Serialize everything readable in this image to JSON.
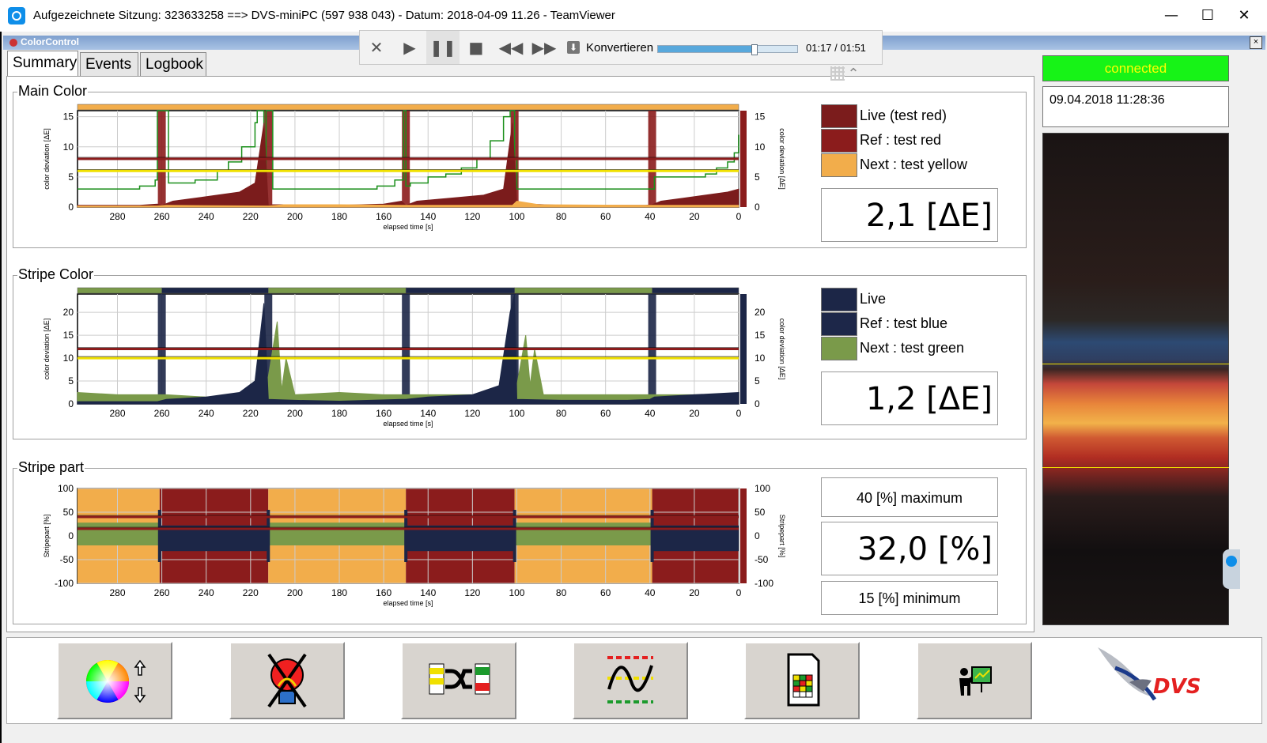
{
  "window": {
    "title": "Aufgezeichnete Sitzung: 323633258 ==> DVS-miniPC (597 938 043) - Datum: 2018-04-09 11.26 - TeamViewer",
    "minimize": "—",
    "maximize": "☐",
    "close": "✕"
  },
  "app": {
    "title": "ColorControl",
    "close": "×"
  },
  "tabs": [
    "Summary",
    "Events",
    "Logbook"
  ],
  "playback": {
    "convert_label": "Konvertieren",
    "time": "01:17 / 01:51",
    "progress": 0.69
  },
  "status": {
    "connection": "connected",
    "datetime": "09.04.2018 11:28:36"
  },
  "main_color": {
    "title": "Main Color",
    "legend": [
      {
        "label": "Live (test red)",
        "color": "#7b1c1c"
      },
      {
        "label": "Ref : test red",
        "color": "#8b1c1c"
      },
      {
        "label": "Next : test yellow",
        "color": "#f2ad4b"
      }
    ],
    "value": "2,1 [ΔE]"
  },
  "stripe_color": {
    "title": "Stripe Color",
    "legend": [
      {
        "label": "Live",
        "color": "#1c2647"
      },
      {
        "label": "Ref : test blue",
        "color": "#1d2749"
      },
      {
        "label": "Next : test green",
        "color": "#7a9a4a"
      }
    ],
    "value": "1,2 [ΔE]"
  },
  "stripe_part": {
    "title": "Stripe part",
    "maximum": "40 [%] maximum",
    "value": "32,0 [%]",
    "minimum": "15 [%] minimum"
  },
  "chart_data": [
    {
      "type": "line",
      "name": "main-color-chart",
      "xlabel": "elapsed time [s]",
      "ylabel": "color deviation [ΔE]",
      "y2label": "color deviation [ΔE]",
      "xlim": [
        298,
        0
      ],
      "ylim": [
        0,
        16
      ],
      "x_ticks": [
        280,
        260,
        240,
        220,
        200,
        180,
        160,
        140,
        120,
        100,
        80,
        60,
        40,
        20,
        0
      ],
      "y_ticks": [
        0,
        5,
        10,
        15
      ],
      "thresholds": [
        {
          "y": 8,
          "color": "#8b1c1c"
        },
        {
          "y": 6,
          "color": "#f0e000"
        }
      ],
      "markers": [
        260,
        212,
        150,
        101,
        39
      ],
      "series": [
        {
          "color": "#1a8f1a",
          "x": [
            298,
            275,
            270,
            263,
            262,
            257,
            245,
            235,
            230,
            224,
            218,
            217,
            214,
            213,
            210,
            208,
            203,
            190,
            178,
            163,
            155,
            151,
            150,
            148,
            140,
            132,
            125,
            118,
            112,
            106,
            103,
            101,
            100,
            97,
            92,
            82,
            75,
            65,
            55,
            45,
            40,
            38,
            32,
            25,
            15,
            10,
            5,
            2,
            0
          ],
          "y": [
            3,
            3,
            3.5,
            4.5,
            16,
            4,
            4.5,
            6,
            7.5,
            10,
            14,
            16,
            3,
            16,
            3,
            3,
            3,
            3,
            3,
            3.5,
            4.5,
            16,
            3.5,
            4,
            5,
            5.5,
            6.5,
            8,
            11,
            15,
            16,
            8,
            3,
            3,
            3,
            3,
            3,
            3,
            3,
            3,
            3,
            5,
            5,
            5,
            5.5,
            6.5,
            7.5,
            9,
            12
          ]
        },
        {
          "color": "#7b1c1c",
          "x": [
            298,
            270,
            262,
            260,
            255,
            245,
            235,
            225,
            218,
            214,
            212,
            210,
            200,
            180,
            160,
            152,
            150,
            145,
            130,
            115,
            106,
            102,
            100,
            95,
            80,
            60,
            42,
            39,
            35,
            25,
            15,
            5,
            0
          ],
          "y": [
            0.3,
            0.3,
            0.5,
            0.3,
            1,
            1.5,
            2,
            2.5,
            4,
            14,
            0.3,
            0.4,
            0.4,
            0.3,
            0.5,
            1,
            0.3,
            1,
            1.5,
            2,
            3,
            14,
            0.3,
            0.5,
            0.3,
            0.3,
            0.3,
            0.4,
            1,
            1.5,
            2,
            2.5,
            3
          ]
        },
        {
          "color": "#f2ad4b",
          "x": [
            298,
            262,
            258,
            212,
            205,
            180,
            150,
            110,
            102,
            100,
            90,
            40,
            0
          ],
          "y": [
            0.2,
            0.2,
            0.3,
            0.2,
            0.4,
            0.4,
            0.3,
            0.3,
            0.3,
            1,
            0.4,
            0.3,
            0.3
          ]
        }
      ]
    },
    {
      "type": "area",
      "name": "stripe-color-chart",
      "xlabel": "elapsed time [s]",
      "ylabel": "color deviation [ΔE]",
      "y2label": "color deviation [ΔE]",
      "xlim": [
        298,
        0
      ],
      "ylim": [
        0,
        24
      ],
      "x_ticks": [
        280,
        260,
        240,
        220,
        200,
        180,
        160,
        140,
        120,
        100,
        80,
        60,
        40,
        20,
        0
      ],
      "y_ticks": [
        0,
        5,
        10,
        15,
        20
      ],
      "thresholds": [
        {
          "y": 12,
          "color": "#8b1c1c"
        },
        {
          "y": 10,
          "color": "#f0e000"
        }
      ],
      "markers": [
        260,
        212,
        150,
        101,
        39
      ],
      "series": [
        {
          "color": "#7a9a4a",
          "x": [
            298,
            280,
            265,
            258,
            240,
            225,
            218,
            214,
            212,
            208,
            206,
            204,
            200,
            180,
            160,
            152,
            150,
            140,
            120,
            105,
            101,
            100,
            96,
            94,
            92,
            88,
            70,
            50,
            40,
            30,
            10,
            0
          ],
          "y": [
            2.5,
            2,
            2,
            2,
            1.5,
            2,
            3,
            2,
            6,
            18,
            3,
            10,
            2,
            2.5,
            2,
            2,
            2,
            2,
            2,
            2,
            3,
            4,
            15,
            4,
            12,
            2,
            2,
            2,
            2,
            2,
            2,
            2
          ]
        },
        {
          "color": "#1c2647",
          "x": [
            298,
            262,
            258,
            240,
            225,
            218,
            214,
            212,
            200,
            180,
            152,
            150,
            140,
            120,
            108,
            103,
            101,
            100,
            80,
            50,
            40,
            38,
            20,
            0
          ],
          "y": [
            0.5,
            0.5,
            1,
            1.5,
            2.5,
            5,
            22,
            1,
            0.8,
            0.6,
            1,
            1,
            1.5,
            2,
            4,
            20,
            24,
            1,
            0.8,
            0.8,
            1,
            1.5,
            2,
            2.5
          ]
        }
      ]
    },
    {
      "type": "area",
      "name": "stripe-part-chart",
      "xlabel": "elapsed time [s]",
      "ylabel": "Stripepart [%]",
      "y2label": "Stripepart [%]",
      "xlim": [
        298,
        0
      ],
      "ylim": [
        -100,
        100
      ],
      "x_ticks": [
        280,
        260,
        240,
        220,
        200,
        180,
        160,
        140,
        120,
        100,
        80,
        60,
        40,
        20,
        0
      ],
      "y_ticks": [
        100,
        50,
        0,
        -50,
        -100
      ],
      "thresholds": [
        {
          "y": 40,
          "color": "#8b1c1c"
        },
        {
          "y": 15,
          "color": "#8b1c1c"
        }
      ],
      "background_bands": [
        {
          "from": 298,
          "to": 261,
          "color": "#f2ad4b"
        },
        {
          "from": 261,
          "to": 212,
          "color": "#8b1c1c"
        },
        {
          "from": 212,
          "to": 150,
          "color": "#f2ad4b"
        },
        {
          "from": 150,
          "to": 101,
          "color": "#8b1c1c"
        },
        {
          "from": 101,
          "to": 39,
          "color": "#f2ad4b"
        },
        {
          "from": 39,
          "to": 0,
          "color": "#8b1c1c"
        }
      ],
      "series": [
        {
          "name": "green-band",
          "color": "#7a9a4a",
          "range": [
            212,
            150
          ],
          "band": [
            -17,
            30
          ]
        },
        {
          "name": "blue-band",
          "color": "#1c2647",
          "range": [
            261,
            212
          ],
          "band": [
            -30,
            20
          ]
        }
      ]
    }
  ],
  "toolbar": [
    "color-wheel-button",
    "lamp-off-button",
    "shuffle-button",
    "tolerance-button",
    "report-button",
    "presentation-button"
  ],
  "brand": "DVS"
}
